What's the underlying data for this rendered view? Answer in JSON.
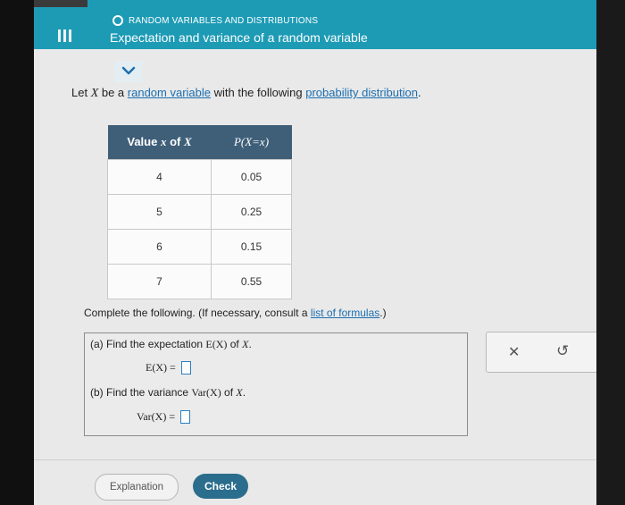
{
  "header": {
    "topic": "RANDOM VARIABLES AND DISTRIBUTIONS",
    "subtitle": "Expectation and variance of a random variable",
    "accent_color": "#1d9bb5"
  },
  "icons": {
    "menu": "menu-icon",
    "topic": "circle-icon",
    "chevron": "chevron-down-icon",
    "close": "close-icon",
    "undo": "undo-icon"
  },
  "problem": {
    "prefix": "Let ",
    "var": "X",
    "mid": " be a ",
    "link1": "random variable",
    "mid2": " with the following ",
    "link2": "probability distribution",
    "suffix": "."
  },
  "table": {
    "header_prefix": "Value ",
    "header_x": "x",
    "header_of": " of ",
    "header_X": "X",
    "header_p": "P(X=x)",
    "rows": [
      {
        "x": "4",
        "p": "0.05"
      },
      {
        "x": "5",
        "p": "0.25"
      },
      {
        "x": "6",
        "p": "0.15"
      },
      {
        "x": "7",
        "p": "0.55"
      }
    ]
  },
  "instructions": {
    "prefix": "Complete the following. (If necessary, consult a ",
    "link": "list of formulas",
    "suffix": ".)"
  },
  "parts": {
    "a_label": "(a) Find the expectation ",
    "a_expr": "E(X)",
    "a_of": " of ",
    "a_var": "X",
    "a_end": ".",
    "a_eq": "E(X) =",
    "b_label": "(b) Find the variance ",
    "b_expr": "Var(X)",
    "b_of": " of ",
    "b_var": "X",
    "b_end": ".",
    "b_eq": "Var(X) ="
  },
  "tools": {
    "close_symbol": "✕",
    "undo_symbol": "↺"
  },
  "buttons": {
    "explanation": "Explanation",
    "check": "Check"
  }
}
